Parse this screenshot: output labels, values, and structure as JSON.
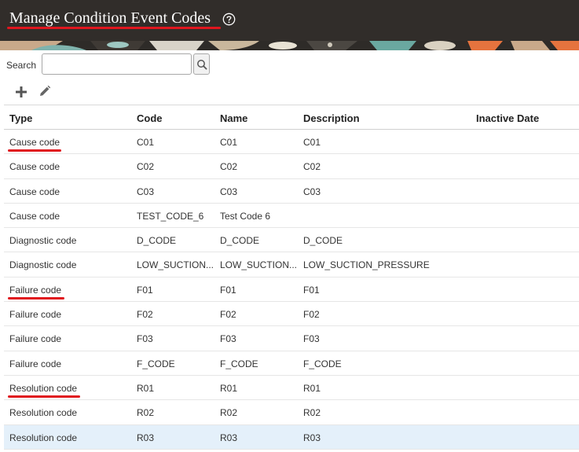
{
  "header": {
    "title": "Manage Condition Event Codes",
    "help_icon": "question-circle-icon",
    "background_color": "#312d2a",
    "title_color": "#ffffff"
  },
  "search": {
    "label": "Search",
    "value": "",
    "placeholder": "",
    "button_icon": "magnifier-icon"
  },
  "toolbar": {
    "add_icon": "plus-icon",
    "edit_icon": "pencil-icon"
  },
  "table": {
    "columns": [
      "Type",
      "Code",
      "Name",
      "Description",
      "Inactive Date"
    ],
    "rows": [
      {
        "type": "Cause code",
        "code": "C01",
        "name": "C01",
        "description": "C01",
        "inactive": ""
      },
      {
        "type": "Cause code",
        "code": "C02",
        "name": "C02",
        "description": "C02",
        "inactive": ""
      },
      {
        "type": "Cause code",
        "code": "C03",
        "name": "C03",
        "description": "C03",
        "inactive": ""
      },
      {
        "type": "Cause code",
        "code": "TEST_CODE_6",
        "name": "Test Code 6",
        "description": "",
        "inactive": ""
      },
      {
        "type": "Diagnostic code",
        "code": "D_CODE",
        "name": "D_CODE",
        "description": "D_CODE",
        "inactive": ""
      },
      {
        "type": "Diagnostic code",
        "code": "LOW_SUCTION...",
        "name": "LOW_SUCTION...",
        "description": "LOW_SUCTION_PRESSURE",
        "inactive": ""
      },
      {
        "type": "Failure code",
        "code": "F01",
        "name": "F01",
        "description": "F01",
        "inactive": ""
      },
      {
        "type": "Failure code",
        "code": "F02",
        "name": "F02",
        "description": "F02",
        "inactive": ""
      },
      {
        "type": "Failure code",
        "code": "F03",
        "name": "F03",
        "description": "F03",
        "inactive": ""
      },
      {
        "type": "Failure code",
        "code": "F_CODE",
        "name": "F_CODE",
        "description": "F_CODE",
        "inactive": ""
      },
      {
        "type": "Resolution code",
        "code": "R01",
        "name": "R01",
        "description": "R01",
        "inactive": ""
      },
      {
        "type": "Resolution code",
        "code": "R02",
        "name": "R02",
        "description": "R02",
        "inactive": ""
      },
      {
        "type": "Resolution code",
        "code": "R03",
        "name": "R03",
        "description": "R03",
        "inactive": ""
      }
    ],
    "selected_row_color": "#e4f0fa"
  },
  "annotation_color": "#e0161e"
}
